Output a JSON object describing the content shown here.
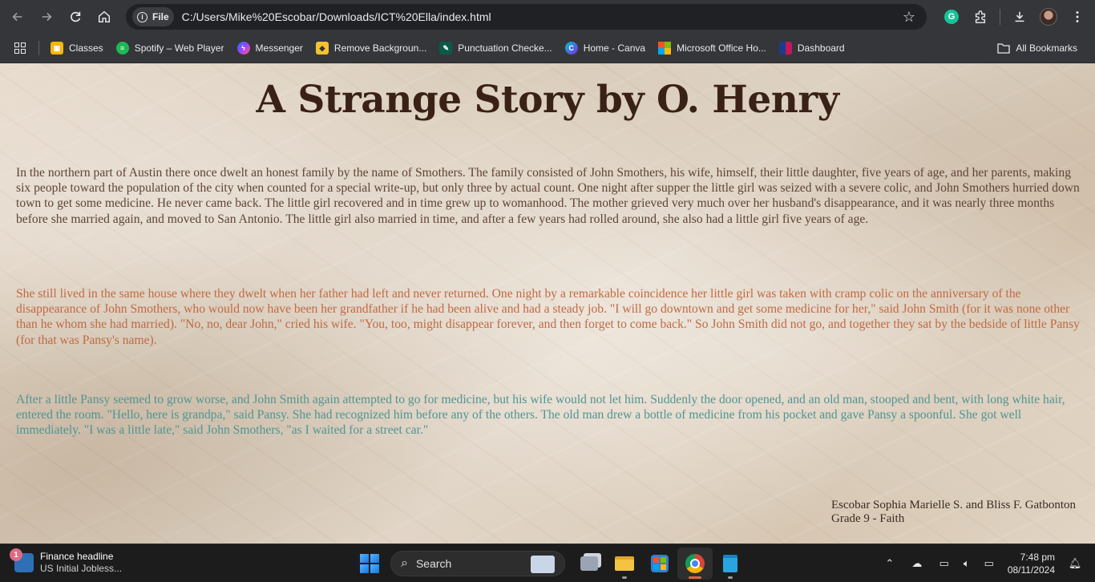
{
  "browser": {
    "chip_label": "File",
    "url": "C:/Users/Mike%20Escobar/Downloads/ICT%20Ella/index.html",
    "icons": [
      "back-icon",
      "forward-icon",
      "reload-icon",
      "home-icon",
      "info-icon",
      "star-icon",
      "grammarly-icon",
      "extensions-icon",
      "downloads-icon",
      "profile-avatar",
      "menu-icon"
    ]
  },
  "bookmarks": {
    "items": [
      {
        "label": "Classes",
        "color": "#f6b70b"
      },
      {
        "label": "Spotify – Web Player",
        "color": "#1db954"
      },
      {
        "label": "Messenger",
        "color": "#a040ff"
      },
      {
        "label": "Remove Backgroun...",
        "color": "#f2c230"
      },
      {
        "label": "Punctuation Checke...",
        "color": "#0a5a4a"
      },
      {
        "label": "Home - Canva",
        "color": "#7d2ae8"
      },
      {
        "label": "Microsoft Office Ho...",
        "color": "#f35325"
      },
      {
        "label": "Dashboard",
        "color": "#c2185b"
      }
    ],
    "all_bookmarks": "All Bookmarks"
  },
  "page": {
    "title": "A Strange Story by O. Henry",
    "paragraphs": [
      "In the northern part of Austin there once dwelt an honest family by the name of Smothers. The family consisted of John Smothers, his wife, himself, their little daughter, five years of age, and her parents, making six people toward the population of the city when counted for a special write-up, but only three by actual count. One night after supper the little girl was seized with a severe colic, and John Smothers hurried down town to get some medicine. He never came back. The little girl recovered and in time grew up to womanhood. The mother grieved very much over her husband's disappearance, and it was nearly three months before she married again, and moved to San Antonio. The little girl also married in time, and after a few years had rolled around, she also had a little girl five years of age.",
      "She still lived in the same house where they dwelt when her father had left and never returned. One night by a remarkable coincidence her little girl was taken with cramp colic on the anniversary of the disappearance of John Smothers, who would now have been her grandfather if he had been alive and had a steady job. \"I will go downtown and get some medicine for her,\" said John Smith (for it was none other than he whom she had married). \"No, no, dear John,\" cried his wife. \"You, too, might disappear forever, and then forget to come back.\" So John Smith did not go, and together they sat by the bedside of little Pansy (for that was Pansy's name).",
      "After a little Pansy seemed to grow worse, and John Smith again attempted to go for medicine, but his wife would not let him. Suddenly the door opened, and an old man, stooped and bent, with long white hair, entered the room. \"Hello, here is grandpa,\" said Pansy. She had recognized him before any of the others. The old man drew a bottle of medicine from his pocket and gave Pansy a spoonful. She got well immediately. \"I was a little late,\" said John Smothers, \"as I waited for a street car.\""
    ],
    "credits_line1": "Escobar Sophia Marielle S. and Bliss F. Gatbonton",
    "credits_line2": "Grade 9 - Faith",
    "colors": {
      "title": "#3a2117",
      "p1": "#5e4436",
      "p2": "#c06a43",
      "p3": "#4f9592"
    }
  },
  "taskbar": {
    "news_badge": "1",
    "news_title": "Finance headline",
    "news_sub": "US Initial Jobless...",
    "search_label": "Search",
    "time": "7:48 pm",
    "date": "08/11/2024"
  }
}
